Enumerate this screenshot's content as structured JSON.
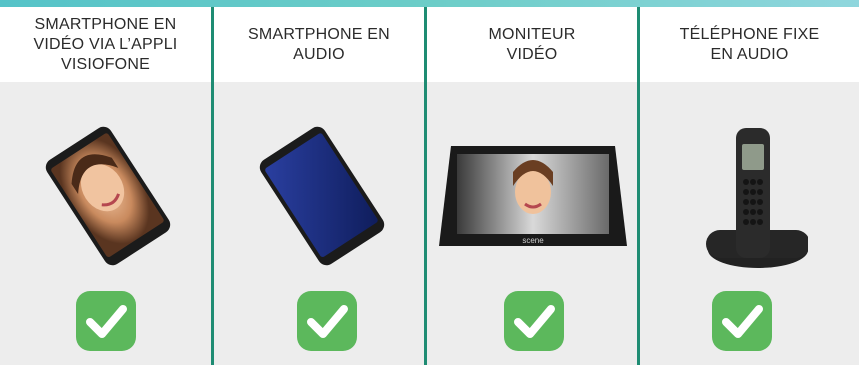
{
  "columns": [
    {
      "title": "SMARTPHONE EN\nVIDÉO VIA L’APPLI\nVISIOFONE",
      "device_icon": "smartphone-video-icon",
      "supported": true
    },
    {
      "title": "SMARTPHONE EN\nAUDIO",
      "device_icon": "smartphone-audio-icon",
      "supported": true
    },
    {
      "title": "MONITEUR\nVIDÉO",
      "device_icon": "video-monitor-icon",
      "supported": true
    },
    {
      "title": "TÉLÉPHONE FIXE\nEN AUDIO",
      "device_icon": "cordless-phone-icon",
      "supported": true
    }
  ],
  "monitor_brand": "scene",
  "colors": {
    "accent_top": "#55c3c8",
    "divider": "#1e8c73",
    "check_green": "#5cb85c",
    "panel_bg": "#ededed"
  }
}
